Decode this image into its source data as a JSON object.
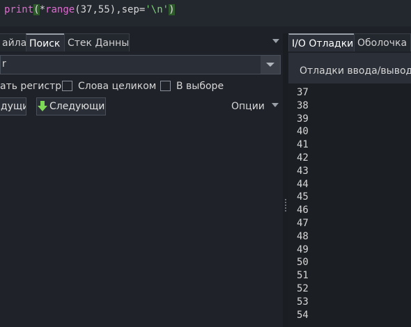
{
  "editor": {
    "code_keyword": "print",
    "code_paren_open": "(",
    "code_args": "*range(37,55),sep='\\n'",
    "code_paren_close": ")"
  },
  "left_tabs": {
    "files_label": "айлах",
    "search_label": "Поиск",
    "stack_label": "Стек Данных"
  },
  "search": {
    "input_value": "r",
    "match_case_label": "ать регистр",
    "whole_words_label": "Слова целиком",
    "in_selection_label": "В выборе",
    "prev_label": "дущий",
    "next_label": "Следующий",
    "options_label": "Опции"
  },
  "right_tabs": {
    "io_label": "I/O Отладки",
    "shell_label": "Оболочка Р"
  },
  "io_panel": {
    "header_label": "Отладки ввода/вывода",
    "output_lines": [
      "37",
      "38",
      "39",
      "40",
      "41",
      "42",
      "43",
      "44",
      "45",
      "46",
      "47",
      "48",
      "49",
      "50",
      "51",
      "52",
      "53",
      "54"
    ]
  },
  "colors": {
    "background": "#1e2228",
    "keyword": "#e06bd0",
    "string": "#7fd07a",
    "paren_highlight": "#2f5a2c",
    "arrow_green": "#7ed957"
  },
  "icons": {
    "tab_menu": "triangle-down-icon",
    "combo_arrow": "chevron-down-icon",
    "next_arrow": "arrow-down-icon",
    "options_arrow": "triangle-down-icon"
  }
}
